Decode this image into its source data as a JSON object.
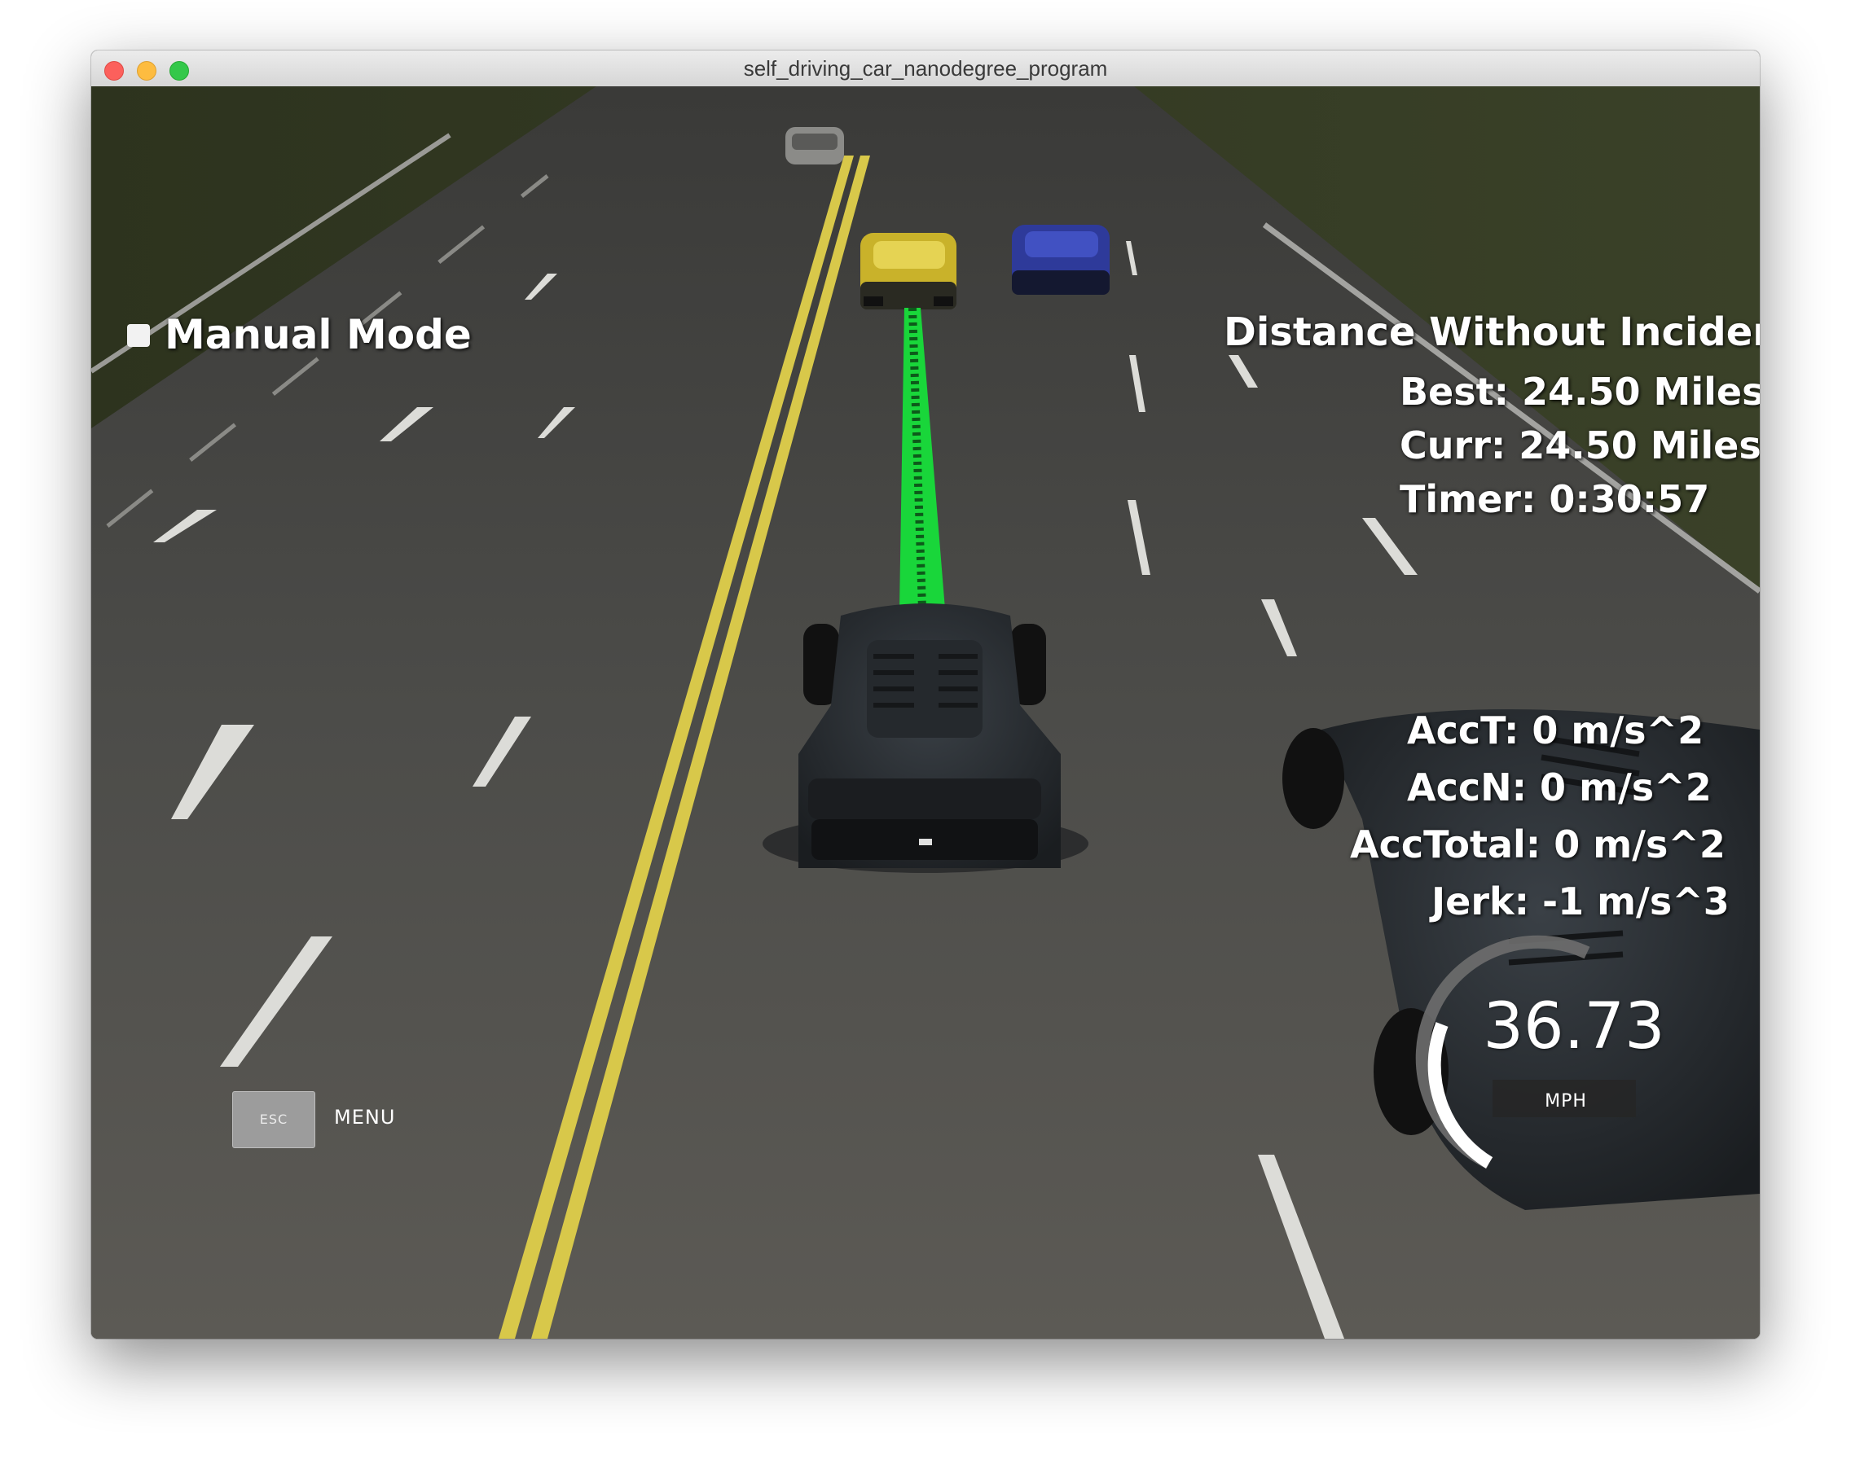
{
  "window": {
    "title": "self_driving_car_nanodegree_program"
  },
  "hud": {
    "mode_label": "Manual Mode",
    "distance_title": "Distance Without Incident",
    "best": "Best: 24.50 Miles",
    "curr": "Curr: 24.50 Miles",
    "timer": "Timer: 0:30:57",
    "acc_t": "AccT: 0 m/s^2",
    "acc_n": "AccN: 0 m/s^2",
    "acc_total": "AccTotal: 0 m/s^2",
    "jerk": "Jerk: -1 m/s^3"
  },
  "speedometer": {
    "value": "36.73",
    "unit": "MPH"
  },
  "menu": {
    "esc_label": "ESC",
    "menu_label": "MENU"
  },
  "colors": {
    "road": "#4a4a48",
    "grass": "#2e3520",
    "lane_yellow": "#d8c84a",
    "path_green": "#19d63a",
    "ego_car": "#2a2f33",
    "car_yellow": "#c9b22a",
    "car_blue": "#2e3a9a"
  },
  "icons": {
    "close": "traffic-light-close-icon",
    "minimize": "traffic-light-minimize-icon",
    "maximize": "traffic-light-maximize-icon"
  }
}
